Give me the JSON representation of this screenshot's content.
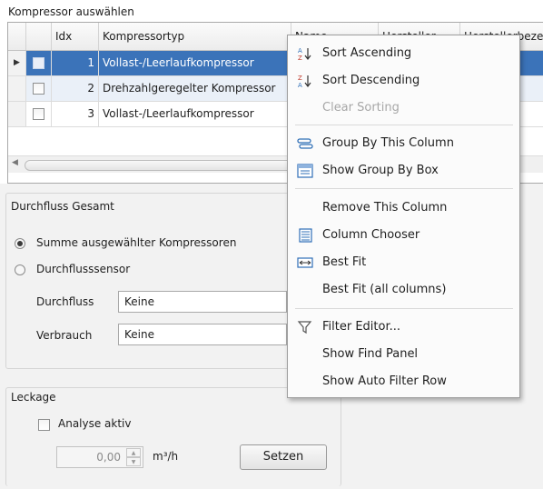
{
  "section_title": "Kompressor auswählen",
  "grid": {
    "columns": [
      "Idx",
      "Kompressortyp",
      "Name",
      "Hersteller",
      "Herstellerbezei"
    ],
    "rows": [
      {
        "idx": "1",
        "typ": "Vollast-/Leerlaufkompressor",
        "selected": true
      },
      {
        "idx": "2",
        "typ": "Drehzahlgeregelter Kompressor",
        "selected": false
      },
      {
        "idx": "3",
        "typ": "Vollast-/Leerlaufkompressor",
        "selected": false
      }
    ]
  },
  "flow": {
    "title": "Durchfluss Gesamt",
    "option_sum": "Summe ausgewählter Kompressoren",
    "option_sensor": "Durchflusssensor",
    "flow_label": "Durchfluss",
    "flow_value": "Keine",
    "consumption_label": "Verbrauch",
    "consumption_value": "Keine"
  },
  "leak": {
    "title": "Leckage",
    "analyse_label": "Analyse aktiv",
    "value": "0,00",
    "unit": "m³/h",
    "set_button": "Setzen"
  },
  "menu": {
    "items": [
      {
        "label": "Sort Ascending",
        "icon": "sort-ascending-icon",
        "disabled": false
      },
      {
        "label": "Sort Descending",
        "icon": "sort-descending-icon",
        "disabled": false
      },
      {
        "label": "Clear Sorting",
        "icon": "",
        "disabled": true
      },
      {
        "label": "Group By This Column",
        "icon": "group-by-icon",
        "disabled": false
      },
      {
        "label": "Show Group By Box",
        "icon": "group-box-icon",
        "disabled": false
      },
      {
        "label": "Remove This Column",
        "icon": "",
        "disabled": false
      },
      {
        "label": "Column Chooser",
        "icon": "column-chooser-icon",
        "disabled": false
      },
      {
        "label": "Best Fit",
        "icon": "best-fit-icon",
        "disabled": false
      },
      {
        "label": "Best Fit (all columns)",
        "icon": "",
        "disabled": false
      },
      {
        "label": "Filter Editor...",
        "icon": "filter-icon",
        "disabled": false
      },
      {
        "label": "Show Find Panel",
        "icon": "",
        "disabled": false
      },
      {
        "label": "Show Auto Filter Row",
        "icon": "",
        "disabled": false
      }
    ]
  },
  "colors": {
    "selection": "#3b73b9",
    "accent_icon": "#2f6fb7",
    "panel": "#f2f2f2"
  }
}
